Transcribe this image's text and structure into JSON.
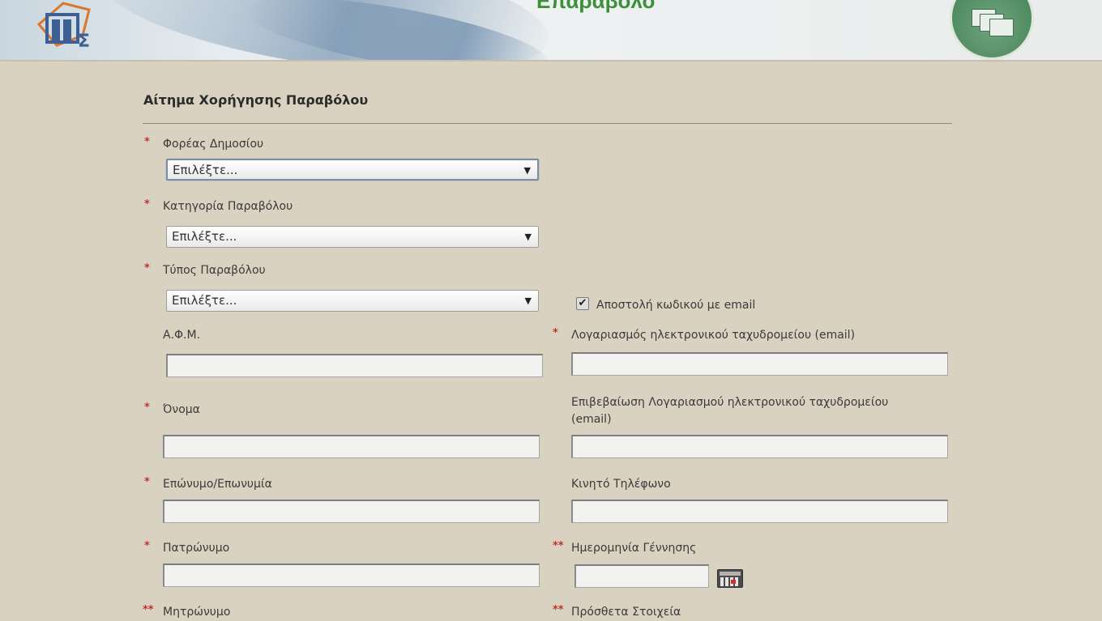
{
  "banner": {
    "title": "Επαράβολο"
  },
  "form": {
    "title": "Αίτημα Χορήγησης Παραβόλου",
    "required_marker": "*",
    "double_required_marker": "**",
    "fields": {
      "foreas": {
        "label": "Φορέας Δημοσίου",
        "value": "Επιλέξτε..."
      },
      "katigoria": {
        "label": "Κατηγορία Παραβόλου",
        "value": "Επιλέξτε..."
      },
      "typos": {
        "label": "Τύπος Παραβόλου",
        "value": "Επιλέξτε..."
      },
      "send_code": {
        "label": "Αποστολή κωδικού με email",
        "checked": true,
        "check_glyph": "✔"
      },
      "afm": {
        "label": "Α.Φ.Μ.",
        "value": ""
      },
      "email": {
        "label": "Λογαριασμός ηλεκτρονικού ταχυδρομείου (email)",
        "value": ""
      },
      "name": {
        "label": "Όνομα",
        "value": ""
      },
      "email_confirm": {
        "label_line1": "Επιβεβαίωση Λογαριασμού ηλεκτρονικού ταχυδρομείου",
        "label_line2": "(email)",
        "value": ""
      },
      "surname": {
        "label": "Επώνυμο/Επωνυμία",
        "value": ""
      },
      "mobile": {
        "label": "Κινητό Τηλέφωνο",
        "value": ""
      },
      "father": {
        "label": "Πατρώνυμο",
        "value": ""
      },
      "birthdate": {
        "label": "Ημερομηνία Γέννησης",
        "value": ""
      },
      "mother": {
        "label": "Μητρώνυμο"
      },
      "extra": {
        "label": "Πρόσθετα Στοιχεία"
      }
    }
  },
  "icons": {
    "select_arrow": "▼"
  }
}
